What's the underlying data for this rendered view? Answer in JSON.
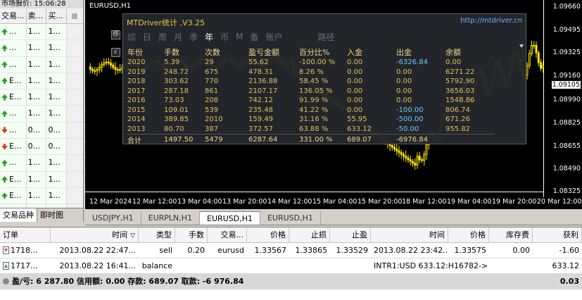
{
  "market_watch": {
    "title": "市场报价: 15:06:28",
    "headers": [
      "交易...",
      "卖...",
      "买..."
    ],
    "rows": [
      {
        "dir": "up",
        "sym": "...",
        "bid": "1...",
        "ask": "1..."
      },
      {
        "dir": "up",
        "sym": "...",
        "bid": "1...",
        "ask": "1..."
      },
      {
        "dir": "up",
        "sym": "...",
        "bid": "1...",
        "ask": "1..."
      },
      {
        "dir": "up",
        "sym": "E...",
        "bid": "1...",
        "ask": "1..."
      },
      {
        "dir": "up",
        "sym": "E...",
        "bid": "1...",
        "ask": "1..."
      },
      {
        "dir": "up",
        "sym": "...",
        "bid": "1...",
        "ask": "1..."
      },
      {
        "dir": "down",
        "sym": "...",
        "bid": "0...",
        "ask": "0..."
      },
      {
        "dir": "down",
        "sym": "E...",
        "bid": "0...",
        "ask": "0..."
      },
      {
        "dir": "up",
        "sym": "...",
        "bid": "1...",
        "ask": "1..."
      },
      {
        "dir": "up",
        "sym": "E...",
        "bid": "1...",
        "ask": "1..."
      },
      {
        "dir": "up",
        "sym": "E...",
        "bid": "1...",
        "ask": "1..."
      },
      {
        "dir": "up",
        "sym": "...",
        "bid": "1...",
        "ask": "1..."
      }
    ],
    "tab_symbols": "交易品种",
    "tab_tick": "即时图"
  },
  "chart": {
    "symbol_title": "EURUSD,H1",
    "prices": [
      "1.09660",
      "1.09495",
      "1.09325",
      "1.09160",
      "1.09105",
      "1.08990",
      "1.08825",
      "1.08655",
      "1.08490",
      "1.08325"
    ],
    "current_price": "1.09105",
    "time_labels": [
      "12 Mar 2024",
      "12 Mar 12:00",
      "13 Mar 04:00",
      "13 Mar 20:00",
      "14 Mar 12:00",
      "15 Mar 04:00",
      "15 Mar 20:00",
      "18 Mar 12:00",
      "19 Mar 04:00",
      "19 Mar 20:00",
      "20 Mar 12:00",
      "21 Mar 04:00",
      "21 Mar 12:00"
    ],
    "side_buttons": [
      "移",
      "√"
    ]
  },
  "mtdriver": {
    "title": "MTDriver统计 ,V3.25",
    "url": "http://mtdriver.cn",
    "tabs": [
      "综",
      "日",
      "周",
      "月",
      "季",
      "年",
      "币",
      "M",
      "备",
      "账户",
      "路径"
    ],
    "active_tab": "年",
    "columns": [
      "年份",
      "手数",
      "次数",
      "盈亏金额",
      "百分比%",
      "入金",
      "出金",
      "余额"
    ],
    "rows": [
      [
        "2020",
        "5.39",
        "29",
        "55.62",
        "-100.00 %",
        "0.00",
        "-6326.84",
        "0.00"
      ],
      [
        "2019",
        "248.72",
        "675",
        "478.31",
        "8.26 %",
        "0.00",
        "0.00",
        "6271.22"
      ],
      [
        "2018",
        "303.62",
        "770",
        "2136.88",
        "58.45 %",
        "0.00",
        "0.00",
        "5792.90"
      ],
      [
        "2017",
        "287.18",
        "861",
        "2107.17",
        "136.05 %",
        "0.00",
        "0.00",
        "3656.03"
      ],
      [
        "2016",
        "73.03",
        "208",
        "742.12",
        "91.99 %",
        "0.00",
        "0.00",
        "1548.86"
      ],
      [
        "2015",
        "109.01",
        "539",
        "235.48",
        "41.22 %",
        "0.00",
        "-100.00",
        "806.74"
      ],
      [
        "2014",
        "389.85",
        "2010",
        "159.49",
        "31.16 %",
        "55.95",
        "-500.00",
        "671.26"
      ],
      [
        "2013",
        "80.70",
        "387",
        "372.57",
        "63.88 %",
        "633.12",
        "-50.00",
        "955.82"
      ]
    ],
    "total": [
      "合计",
      "1497.50",
      "5479",
      "6287.64",
      "331.00 %",
      "689.07",
      "-6976.84",
      ""
    ]
  },
  "chart_tabs": [
    "USDJPY,H1",
    "EURPLN,H1",
    "EURUSD,H1",
    "EURUSD,H1"
  ],
  "chart_tab_active": 2,
  "terminal": {
    "headers": [
      "订单",
      "时间",
      "类型",
      "手数",
      "交易...",
      "价格",
      "止损",
      "止盈",
      "时间",
      "价格",
      "库存费",
      "获利"
    ],
    "sort_glyph": "▽",
    "rows": [
      [
        "1718...",
        "2013.08.22 22:47...",
        "sell",
        "0.20",
        "eurusd",
        "1.33567",
        "1.33865",
        "1.33529",
        "2013.08.22 23:42...",
        "1.33575",
        "0.00",
        "-1.60"
      ],
      [
        "1717...",
        "2013.08.22 16:41...",
        "balance",
        "",
        "",
        "",
        "",
        "",
        "INTR1:USD 633.12:H16782->",
        "",
        "",
        "633.12"
      ]
    ],
    "summary": "盈/亏: 6 287.80  信用额: 0.00  存款: 689.07  取款: -6 976.84",
    "summary_value": "0.03"
  }
}
